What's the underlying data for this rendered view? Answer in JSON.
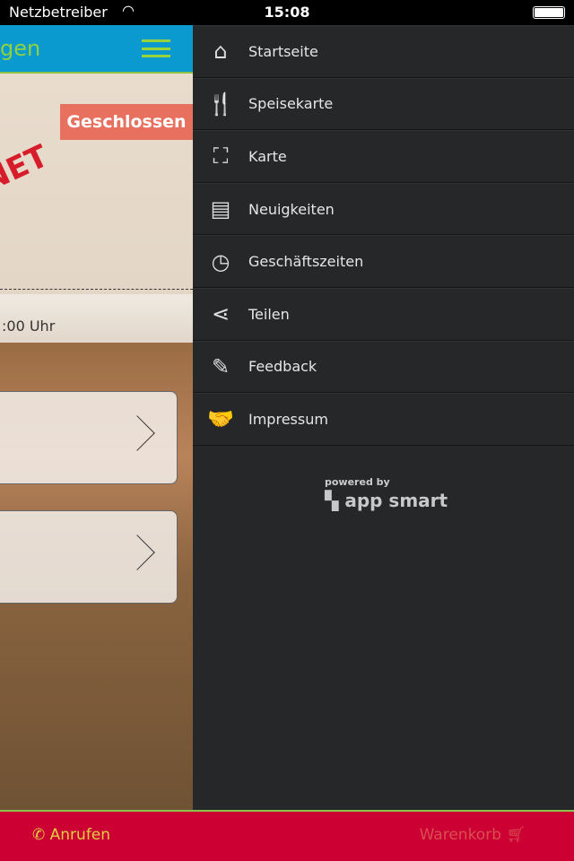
{
  "status_bar": {
    "carrier": "Netzbetreiber",
    "time": "15:08"
  },
  "header": {
    "title": "gen"
  },
  "main": {
    "status_badge": "Geschlossen",
    "hours_text": ":00 Uhr",
    "logo_text": "NET"
  },
  "menu": {
    "items": [
      {
        "label": "Startseite",
        "icon": "home-icon"
      },
      {
        "label": "Speisekarte",
        "icon": "cutlery-icon"
      },
      {
        "label": "Karte",
        "icon": "map-icon"
      },
      {
        "label": "Neuigkeiten",
        "icon": "news-icon"
      },
      {
        "label": "Geschäftszeiten",
        "icon": "delivery-clock-icon"
      },
      {
        "label": "Teilen",
        "icon": "share-icon"
      },
      {
        "label": "Feedback",
        "icon": "feedback-icon"
      },
      {
        "label": "Impressum",
        "icon": "handshake-icon"
      }
    ],
    "powered_by": "powered by",
    "brand": "app smart"
  },
  "bottom_bar": {
    "call_label": "Anrufen",
    "cart_label": "Warenkorb"
  },
  "colors": {
    "header": "#0a9ad0",
    "accent": "#8bc34a",
    "bottom": "#cc0033",
    "badge": "#e8705e",
    "menu_bg": "#262729"
  }
}
